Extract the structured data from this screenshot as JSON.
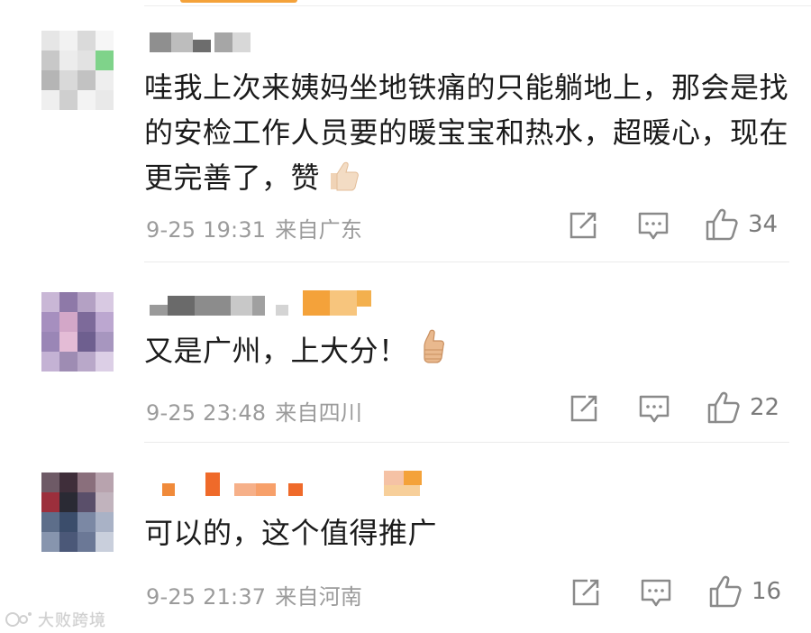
{
  "comments": [
    {
      "text": "哇我上次来姨妈坐地铁痛的只能躺地上，那会是找的安检工作人员要的暖宝宝和热水，超暖心，现在更完善了，赞",
      "emoji": "thumbs-up-emoji",
      "date": "9-25 19:31",
      "location": "来自广东",
      "likes": "34"
    },
    {
      "text": "又是广州，上大分！",
      "emoji": "thumbs-up-emoji",
      "date": "9-25 23:48",
      "location": "来自四川",
      "likes": "22"
    },
    {
      "text": "可以的，这个值得推广",
      "date": "9-25 21:37",
      "location": "来自河南",
      "likes": "16"
    }
  ],
  "icons": {
    "share": "share-icon",
    "comment": "comment-icon",
    "like": "like-icon"
  },
  "colors": {
    "accent": "#f4a23a",
    "text": "#1b1b1b",
    "meta": "#9b9b9b",
    "icon": "#8a8a8a"
  },
  "watermark": {
    "text": "大败跨境"
  }
}
